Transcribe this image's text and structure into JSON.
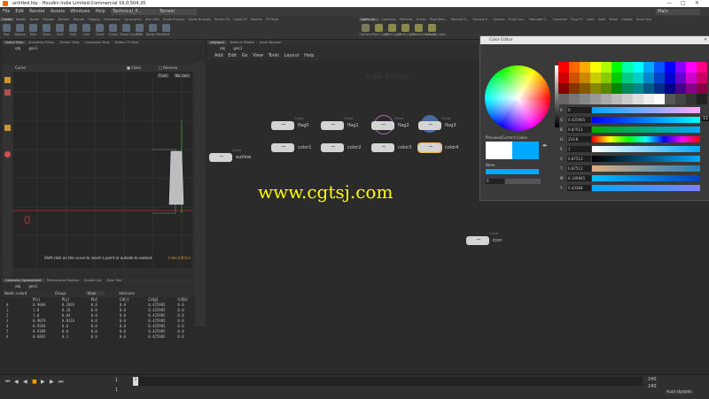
{
  "window": {
    "title": "untitled.hip - Houdini Indie Limited-Commercial 16.0.504.20"
  },
  "menu": [
    "File",
    "Edit",
    "Render",
    "Assets",
    "Windows",
    "Help"
  ],
  "desktop": {
    "tab1": "Technical_P...",
    "tab2": "Terrain",
    "main": "Main"
  },
  "shelf_tabs": [
    "Create",
    "Modify",
    "Model",
    "Polygon",
    "Deform",
    "Texture",
    "Rigging",
    "Characters",
    "Constraints",
    "Hair Utils",
    "Guide Process",
    "Guide Brushes",
    "Terrain FX",
    "Cloud FX",
    "Volume",
    "TD Tools"
  ],
  "shelf_tabs_right": [
    "Lights an...",
    "Collisions",
    "Particles",
    "Grains",
    "Rigid Bod...",
    "Particle Fl...",
    "Viscous F...",
    "Oceans",
    "Fluid Con...",
    "Populate C...",
    "Container",
    "Pyro FX",
    "Cloth",
    "Solid",
    "Wires",
    "Crowds",
    "Drive Sim"
  ],
  "tools": [
    "Box",
    "Sphere",
    "Tube",
    "Torus",
    "Grid",
    "Null",
    "Line",
    "Circle",
    "Curve",
    "Draw Curve",
    "Path",
    "Spray Paint",
    "Font"
  ],
  "tools_right": [
    "Camera",
    "Point Light",
    "Spot Light",
    "Area Light",
    "Geometry Light",
    "Volume Light"
  ],
  "left_tabs": [
    "Scene View",
    "Animation Editor",
    "Render View",
    "Composite View",
    "Motion FX View"
  ],
  "path": {
    "obj": "obj",
    "geo": "geo1"
  },
  "viewport": {
    "tool": "Curve",
    "close": "Close",
    "reverse": "Reverse",
    "cam": "Front",
    "nocam": "No cam",
    "hint": "Shift-click on the curve to insert a point or outside to extend.",
    "edition": "Indie Edition"
  },
  "net_tabs": [
    "/obj/geo1",
    "Material Palette",
    "Asset Browser"
  ],
  "net_menu": [
    "Add",
    "Edit",
    "Go",
    "View",
    "Tools",
    "Layout",
    "Help"
  ],
  "net_watermark": "Indie Edition",
  "nodes": [
    {
      "type": "Curve",
      "name": "flag0"
    },
    {
      "type": "Curve",
      "name": "flag1"
    },
    {
      "type": "Curve",
      "name": "flag2"
    },
    {
      "type": "Curve",
      "name": "flag3"
    },
    {
      "type": "Color",
      "name": "color1"
    },
    {
      "type": "Color",
      "name": "color2"
    },
    {
      "type": "Color",
      "name": "color3"
    },
    {
      "type": "Color",
      "name": "color4"
    },
    {
      "type": "Curve",
      "name": "outline"
    },
    {
      "type": "Curve",
      "name": "icon"
    }
  ],
  "spreadsheet": {
    "tabs": [
      "Geometry Spreadsheet",
      "Performance Monitor",
      "Bundle List",
      "Data Tree"
    ],
    "node_label": "Node: color4",
    "group": "Group:",
    "view": "View",
    "intrinsics": "Intrinsics",
    "columns": [
      "",
      "P[x]",
      "P[y]",
      "P[z]",
      "Cd[r]",
      "Cd[g]",
      "Cd[b]"
    ],
    "rows": [
      [
        "0",
        "0.9069",
        "0.2893",
        "0.0",
        "0.0",
        "0.425905",
        "0.0"
      ],
      [
        "1",
        "1.0",
        "0.26",
        "0.0",
        "0.0",
        "0.425905",
        "0.0"
      ],
      [
        "2",
        "1.0",
        "0.04",
        "0.0",
        "0.0",
        "0.425905",
        "0.0"
      ],
      [
        "3",
        "0.9079",
        "0.0116",
        "0.0",
        "0.0",
        "0.425905",
        "0.0"
      ],
      [
        "4",
        "0.9594",
        "0.0",
        "0.0",
        "0.0",
        "0.425905",
        "0.0"
      ],
      [
        "5",
        "0.9389",
        "0.0",
        "0.0",
        "0.0",
        "0.425905",
        "0.0"
      ],
      [
        "6",
        "0.6892",
        "0.3",
        "0.0",
        "0.0",
        "0.425905",
        "0.0"
      ]
    ]
  },
  "color_editor": {
    "title": "Color Editor",
    "prev_label": "Previous/Current Colors",
    "none_label": "None",
    "value_field": "0",
    "channels": [
      {
        "k": "R",
        "v": "0"
      },
      {
        "k": "G",
        "v": "0.425905"
      },
      {
        "k": "B",
        "v": "0.87513"
      },
      {
        "k": "H",
        "v": "210.8"
      },
      {
        "k": "S",
        "v": "1"
      },
      {
        "k": "V",
        "v": "0.87513"
      },
      {
        "k": "T",
        "v": "0.87513"
      },
      {
        "k": "M",
        "v": "0.149845"
      },
      {
        "k": "Y",
        "v": "0.43368"
      }
    ],
    "side_num": "13",
    "palette": [
      "#ff0000",
      "#ff6600",
      "#ffaa00",
      "#ffff00",
      "#aaff00",
      "#00ff00",
      "#00ffaa",
      "#00ffff",
      "#00aaff",
      "#0055ff",
      "#0000ff",
      "#8800ff",
      "#ff00ff",
      "#ff0088",
      "#cc0000",
      "#cc5200",
      "#cc8800",
      "#cccc00",
      "#88cc00",
      "#00cc00",
      "#00cc88",
      "#00cccc",
      "#0088cc",
      "#0044cc",
      "#0000cc",
      "#6600cc",
      "#cc00cc",
      "#cc0066",
      "#880000",
      "#883600",
      "#885a00",
      "#888800",
      "#5a8800",
      "#008800",
      "#00885a",
      "#008888",
      "#005a88",
      "#002d88",
      "#000088",
      "#440088",
      "#880088",
      "#880044",
      "#666666",
      "#777777",
      "#888888",
      "#999999",
      "#aaaaaa",
      "#bbbbbb",
      "#cccccc",
      "#dddddd",
      "#eeeeee",
      "#ffffff",
      "#555555",
      "#444444",
      "#333333",
      "#222222"
    ],
    "current_color": "#00a9ff",
    "previous_color": "#ffffff"
  },
  "watermark": "www.cgtsj.com",
  "timeline": {
    "frame": "1",
    "start": "1",
    "end": "1",
    "end2": "240",
    "end3": "240",
    "auto": "Auto Update"
  }
}
